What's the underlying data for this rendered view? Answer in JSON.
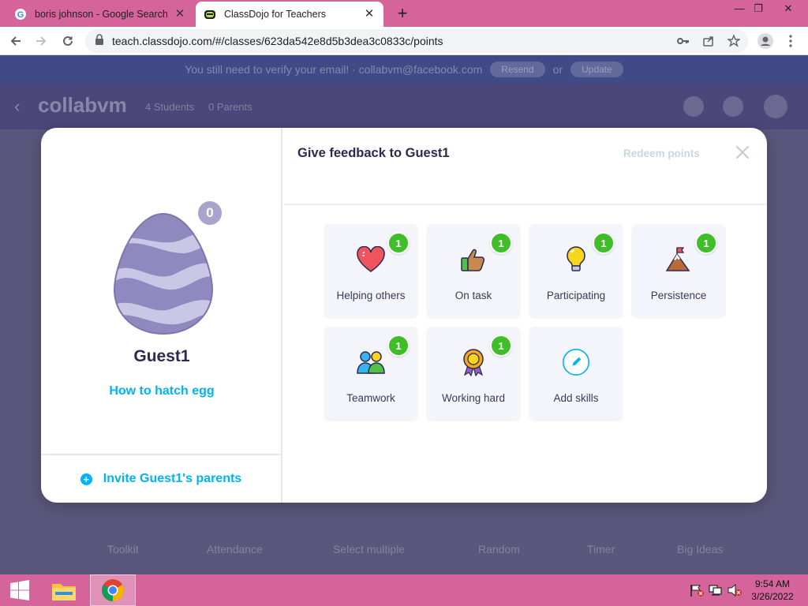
{
  "browser": {
    "tabs": [
      {
        "title": "boris johnson - Google Search",
        "icon": "google-icon",
        "active": false
      },
      {
        "title": "ClassDojo for Teachers",
        "icon": "classdojo-icon",
        "active": true
      }
    ],
    "url": "teach.classdojo.com/#/classes/623da542e8d5b3dea3c0833c/points",
    "new_tab": "+",
    "close_glyph": "✕"
  },
  "background_page": {
    "banner_text": "You still need to verify your email! · collabvm@facebook.com",
    "banner_resend": "Resend",
    "banner_or": "or",
    "banner_update": "Update",
    "class_name": "collabvm",
    "students": "4 Students",
    "parents": "0 Parents",
    "tools": [
      "Toolkit",
      "Attendance",
      "Select multiple",
      "Random",
      "Timer",
      "Big Ideas"
    ]
  },
  "student_panel": {
    "points": "0",
    "name": "Guest1",
    "hatch_link": "How to hatch egg",
    "invite_label": "Invite Guest1's parents"
  },
  "feedback_panel": {
    "title": "Give feedback to Guest1",
    "redeem": "Redeem points",
    "skills": [
      {
        "label": "Helping others",
        "count": "1",
        "icon": "heart-icon"
      },
      {
        "label": "On task",
        "count": "1",
        "icon": "thumbs-up-icon"
      },
      {
        "label": "Participating",
        "count": "1",
        "icon": "lightbulb-icon"
      },
      {
        "label": "Persistence",
        "count": "1",
        "icon": "mountain-flag-icon"
      },
      {
        "label": "Teamwork",
        "count": "1",
        "icon": "teamwork-icon"
      },
      {
        "label": "Working hard",
        "count": "1",
        "icon": "award-ribbon-icon"
      },
      {
        "label": "Add skills",
        "icon": "pencil-icon"
      }
    ]
  },
  "taskbar": {
    "time": "9:54 AM",
    "date": "3/26/2022"
  },
  "colors": {
    "accent_blue": "#00b2f7",
    "count_green": "#3fbe2a",
    "chrome_pink": "#d5649a",
    "points_badge": "#a8a4cc"
  }
}
